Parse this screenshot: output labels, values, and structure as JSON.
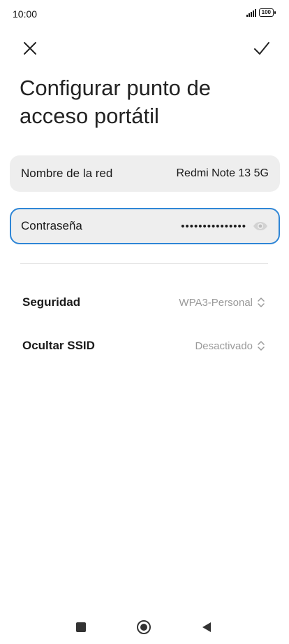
{
  "status_bar": {
    "time": "10:00",
    "battery": "100"
  },
  "header": {
    "close_icon": "close-icon",
    "confirm_icon": "check-icon",
    "title": "Configurar punto de acceso portátil"
  },
  "network_field": {
    "label": "Nombre de la red",
    "value": "Redmi Note 13 5G"
  },
  "password_field": {
    "label": "Contraseña",
    "value": "•••••••••••••••",
    "eye_icon": "eye-icon"
  },
  "security": {
    "label": "Seguridad",
    "value": "WPA3-Personal",
    "icon": "up-down-chevron-icon"
  },
  "hide_ssid": {
    "label": "Ocultar SSID",
    "value": "Desactivado",
    "icon": "up-down-chevron-icon"
  },
  "nav_bar": {
    "recents_icon": "square-icon",
    "home_icon": "circle-icon",
    "back_icon": "triangle-back-icon"
  },
  "colors": {
    "accent": "#2f86d6",
    "field_background": "#eeeeee",
    "secondary_text": "#9a9a9a"
  }
}
